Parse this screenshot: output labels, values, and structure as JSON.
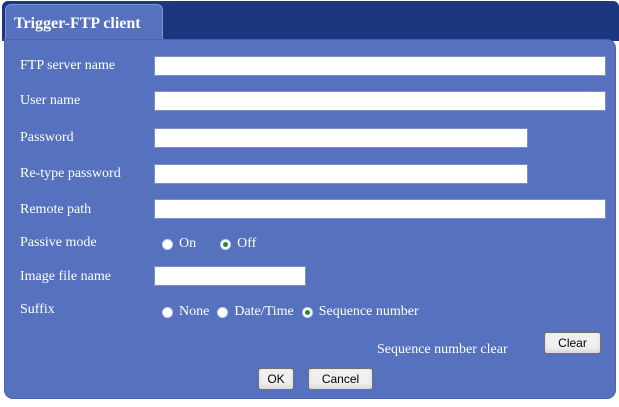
{
  "tab": {
    "label": "Trigger-FTP client"
  },
  "form": {
    "ftp_server_name": {
      "label": "FTP server name",
      "value": ""
    },
    "user_name": {
      "label": "User name",
      "value": ""
    },
    "password": {
      "label": "Password",
      "value": ""
    },
    "retype_password": {
      "label": "Re-type password",
      "value": ""
    },
    "remote_path": {
      "label": "Remote path",
      "value": ""
    },
    "passive_mode": {
      "label": "Passive mode",
      "options": [
        "On",
        "Off"
      ],
      "selected": "Off"
    },
    "image_file_name": {
      "label": "Image file name",
      "value": ""
    },
    "suffix": {
      "label": "Suffix",
      "options": [
        "None",
        "Date/Time",
        "Sequence number"
      ],
      "selected": "Sequence number"
    },
    "sequence_clear": {
      "label": "Sequence number clear",
      "button": "Clear"
    }
  },
  "actions": {
    "ok": "OK",
    "cancel": "Cancel"
  },
  "colors": {
    "header": "#1d3680",
    "panel": "#5671bd",
    "radio_checked": "#2a8a2a"
  }
}
